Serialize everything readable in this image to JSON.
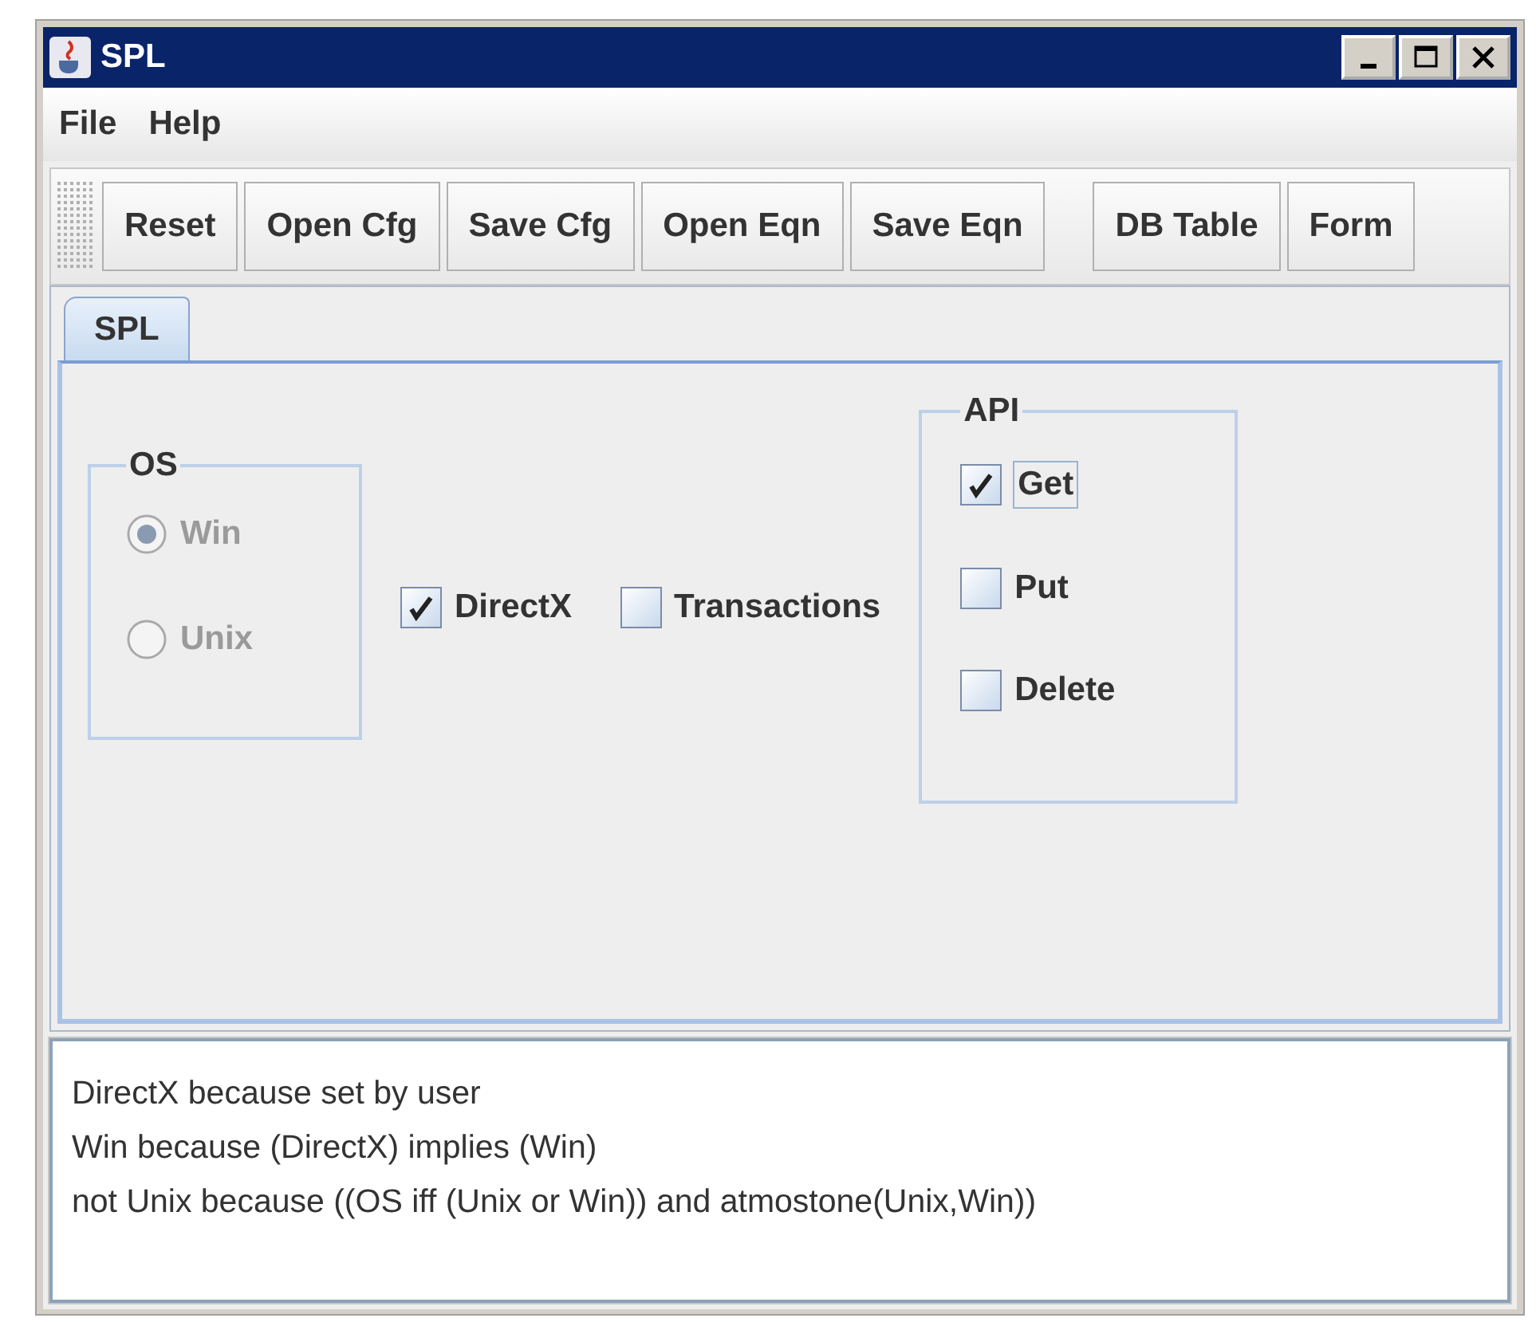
{
  "window": {
    "title": "SPL"
  },
  "menu": [
    "File",
    "Help"
  ],
  "toolbar": {
    "groups": [
      [
        "Reset",
        "Open Cfg",
        "Save Cfg",
        "Open Eqn",
        "Save Eqn"
      ],
      [
        "DB Table",
        "Form"
      ]
    ]
  },
  "tabs": [
    {
      "label": "SPL",
      "selected": true
    }
  ],
  "os": {
    "title": "OS",
    "options": [
      {
        "label": "Win",
        "selected": true,
        "disabled": true
      },
      {
        "label": "Unix",
        "selected": false,
        "disabled": true
      }
    ]
  },
  "options": [
    {
      "label": "DirectX",
      "checked": true
    },
    {
      "label": "Transactions",
      "checked": false
    }
  ],
  "api": {
    "title": "API",
    "items": [
      {
        "label": "Get",
        "checked": true,
        "focused": true
      },
      {
        "label": "Put",
        "checked": false,
        "focused": false
      },
      {
        "label": "Delete",
        "checked": false,
        "focused": false
      }
    ]
  },
  "log": {
    "lines": [
      "DirectX because set by user",
      "Win because (DirectX) implies (Win)",
      "not Unix because ((OS iff (Unix or Win)) and atmostone(Unix,Win))"
    ]
  }
}
